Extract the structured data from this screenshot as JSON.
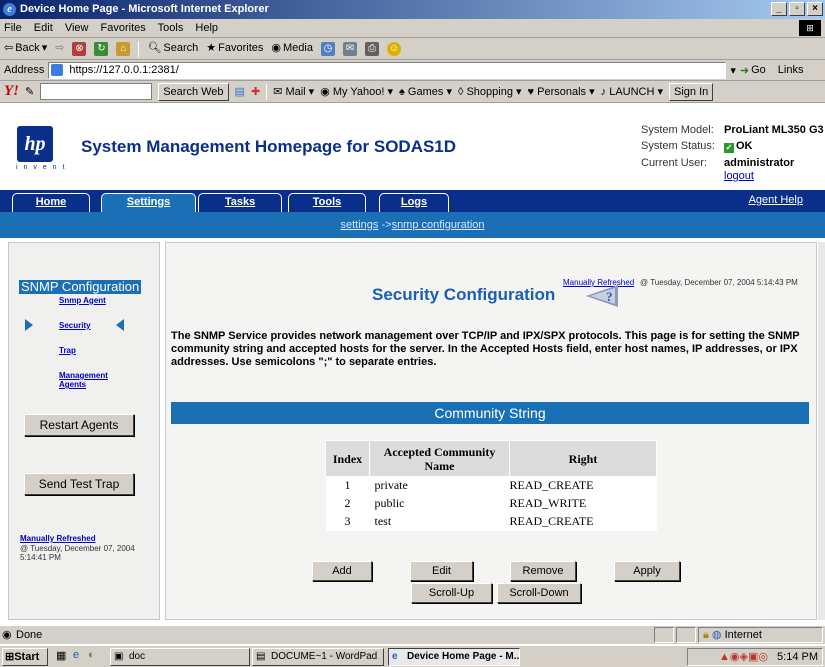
{
  "window": {
    "title": "Device Home Page - Microsoft Internet Explorer"
  },
  "menu": [
    "File",
    "Edit",
    "View",
    "Favorites",
    "Tools",
    "Help"
  ],
  "toolbar": {
    "back": "Back",
    "search": "Search",
    "favorites": "Favorites",
    "media": "Media"
  },
  "addressbar": {
    "label": "Address",
    "url": "https://127.0.0.1:2381/",
    "go": "Go",
    "links": "Links"
  },
  "yahoo": {
    "search_web": "Search Web",
    "mail": "Mail",
    "my_yahoo": "My Yahoo!",
    "games": "Games",
    "shopping": "Shopping",
    "personals": "Personals",
    "launch": "LAUNCH",
    "sign_in": "Sign In"
  },
  "header": {
    "site_title": "System Management Homepage for SODAS1D",
    "logo_text": "hp",
    "logo_sub": "i n v e n t",
    "model_label": "System Model:",
    "model_value": "ProLiant ML350 G3",
    "status_label": "System Status:",
    "status_value": "OK",
    "user_label": "Current User:",
    "user_value": "administrator",
    "logout": "logout"
  },
  "tabs": [
    {
      "label": "Home"
    },
    {
      "label": "Settings"
    },
    {
      "label": "Tasks"
    },
    {
      "label": "Tools"
    },
    {
      "label": "Logs"
    }
  ],
  "agent_help": "Agent Help",
  "breadcrumb": {
    "root": "settings",
    "arrow": " ->",
    "current": "snmp configuration"
  },
  "sidebar": {
    "title": "SNMP Configuration",
    "items": [
      {
        "label": "Snmp Agent"
      },
      {
        "label": "Security"
      },
      {
        "label": "Trap"
      },
      {
        "label": "Management Agents"
      }
    ],
    "restart_button": "Restart Agents",
    "send_trap_button": "Send Test Trap",
    "refresh_link": "Manually Refreshed",
    "refresh_date": "@ Tuesday, December 07, 2004 5:14:41 PM"
  },
  "main": {
    "refresh_link": "Manually Refreshed",
    "refresh_date": "@ Tuesday, December 07, 2004 5:14:43 PM",
    "title": "Security Configuration",
    "description": "The SNMP Service provides network management over TCP/IP and IPX/SPX protocols. This page is for setting the SNMP community string and accepted hosts for the server. In the Accepted Hosts field, enter host names, IP addresses, or IPX addresses. Use semicolons \";\" to separate entries.",
    "section_title": "Community String",
    "table": {
      "headers": [
        "Index",
        "Accepted Community Name",
        "Right"
      ],
      "rows": [
        {
          "index": "1",
          "name": "private",
          "right": "READ_CREATE"
        },
        {
          "index": "2",
          "name": "public",
          "right": "READ_WRITE"
        },
        {
          "index": "3",
          "name": "test",
          "right": "READ_CREATE"
        }
      ]
    },
    "buttons": {
      "add": "Add",
      "edit": "Edit",
      "remove": "Remove",
      "apply": "Apply",
      "scroll_up": "Scroll-Up",
      "scroll_down": "Scroll-Down"
    }
  },
  "statusbar": {
    "status": "Done",
    "zone": "Internet"
  },
  "taskbar": {
    "start": "Start",
    "tasks": [
      {
        "label": "doc"
      },
      {
        "label": "DOCUME~1 - WordPad"
      },
      {
        "label": "Device Home Page - M..."
      }
    ],
    "clock": "5:14 PM"
  }
}
